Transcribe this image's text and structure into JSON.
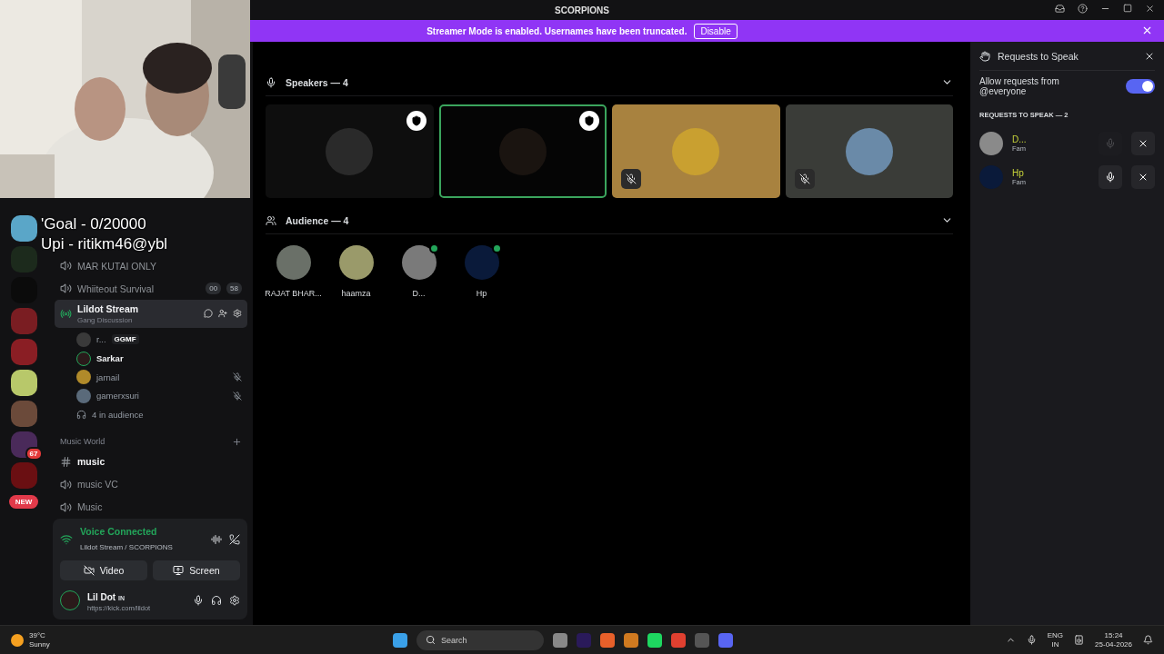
{
  "title_bar": {
    "title": "SCORPIONS"
  },
  "banner": {
    "text": "Streamer Mode is enabled. Usernames have been truncated.",
    "button": "Disable"
  },
  "stream_overlay": {
    "lines": [
      "'Goal - 0/20000",
      "Upi - ritikm46@ybl"
    ]
  },
  "server_rail": [
    {
      "color": "#5aa6c8"
    },
    {
      "color": "#1c2a1c"
    },
    {
      "color": "#0b0b0b"
    },
    {
      "color": "#7a1d22"
    },
    {
      "color": "#8a1e24"
    },
    {
      "color": "#b8c86a"
    },
    {
      "color": "#6b4a3a"
    },
    {
      "color": "#4a2a5a",
      "badge": "67"
    },
    {
      "color": "#6a0f12"
    }
  ],
  "server_new_badge": "NEW",
  "channels": [
    {
      "kind": "voice",
      "name": "MAR KUTAI ONLY",
      "selected": false
    },
    {
      "kind": "voice",
      "name": "Whiiteout Survival",
      "selected": false,
      "counts": [
        "00",
        "58"
      ]
    },
    {
      "kind": "stage",
      "name": "Lildot Stream",
      "topic": "Gang Discussion",
      "selected": true
    }
  ],
  "members": [
    {
      "name": "r...",
      "tag": "GGMF",
      "muted": false,
      "speaking": false,
      "color": "#3a3a3a"
    },
    {
      "name": "Sarkar",
      "muted": false,
      "speaking": true,
      "color": "#2a1a1a"
    },
    {
      "name": "jarnail",
      "muted": true,
      "speaking": false,
      "color": "#b08a2a"
    },
    {
      "name": "gamerxsuri",
      "muted": true,
      "speaking": false,
      "color": "#5a6a7a"
    }
  ],
  "audience_count": "4 in audience",
  "category": {
    "name": "Music World"
  },
  "music_channels": [
    {
      "kind": "text",
      "name": "music",
      "unread": true
    },
    {
      "kind": "voice",
      "name": "music VC",
      "unread": false
    },
    {
      "kind": "voice",
      "name": "Music",
      "unread": false
    }
  ],
  "voice": {
    "status": "Voice Connected",
    "channel": "Lildot Stream /",
    "server": "SCORPIONS",
    "buttons": [
      "Video",
      "Screen"
    ]
  },
  "user": {
    "name": "Lil Dot",
    "tag": "IN",
    "status": "https://kick.com/lildot"
  },
  "speakers": {
    "title": "Speakers — 4",
    "tiles": [
      {
        "color": "#0e0e0e",
        "moderator": true,
        "muted": false,
        "selected": false
      },
      {
        "color": "#050505",
        "moderator": true,
        "muted": false,
        "selected": true
      },
      {
        "color": "#a8823f",
        "moderator": false,
        "muted": true,
        "selected": false
      },
      {
        "color": "#3a3c38",
        "moderator": false,
        "muted": true,
        "selected": false
      }
    ]
  },
  "audience": {
    "title": "Audience — 4",
    "members": [
      {
        "name": "RAJAT BHAR...",
        "badge": false
      },
      {
        "name": "haamza",
        "badge": false
      },
      {
        "name": "D...",
        "badge": true
      },
      {
        "name": "Hp",
        "badge": true
      }
    ]
  },
  "requests": {
    "title": "Requests to Speak",
    "allow_label": "Allow requests from @everyone",
    "allow_on": true,
    "heading": "REQUESTS TO SPEAK — 2",
    "items": [
      {
        "name": "D...",
        "role": "Fam",
        "invite_disabled": true
      },
      {
        "name": "Hp",
        "role": "Fam",
        "invite_disabled": false
      }
    ]
  },
  "taskbar": {
    "temperature": "39°C",
    "weather": "Sunny",
    "search": "Search",
    "lang": "ENG",
    "region": "IN",
    "time": "15:24",
    "date": "25-04-2026"
  }
}
